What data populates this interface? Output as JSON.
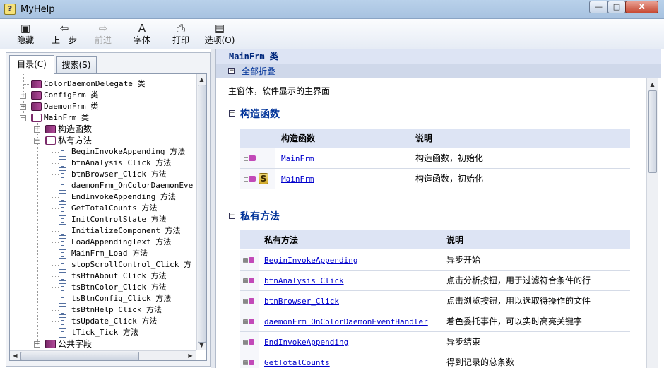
{
  "window": {
    "title": "MyHelp",
    "controls": {
      "minimize": "—",
      "maximize": "□",
      "close": "X"
    }
  },
  "toolbar": {
    "hide": {
      "label": "隐藏",
      "icon": "hide-pane-icon"
    },
    "back": {
      "label": "上一步",
      "icon": "back-arrow-icon"
    },
    "forward": {
      "label": "前进",
      "icon": "forward-arrow-icon",
      "disabled": true
    },
    "font": {
      "label": "字体",
      "icon": "font-icon"
    },
    "print": {
      "label": "打印",
      "icon": "printer-icon"
    },
    "options": {
      "label": "选项(O)",
      "icon": "options-icon"
    }
  },
  "left_panel": {
    "tabs": [
      {
        "label": "目录(C)",
        "active": true
      },
      {
        "label": "搜索(S)",
        "active": false
      }
    ],
    "tree": [
      "ColorDaemonDelegate 类",
      "ConfigFrm 类",
      "DaemonFrm 类",
      "MainFrm 类",
      "构造函数",
      "私有方法",
      "BeginInvokeAppending 方法",
      "btnAnalysis_Click 方法",
      "btnBrowser_Click 方法",
      "daemonFrm_OnColorDaemonEve",
      "EndInvokeAppending 方法",
      "GetTotalCounts 方法",
      "InitControlState 方法",
      "InitializeComponent 方法",
      "LoadAppendingText 方法",
      "MainFrm_Load 方法",
      "stopScrollControl_Click 方",
      "tsBtnAbout_Click 方法",
      "tsBtnColor_Click 方法",
      "tsBtnConfig_Click 方法",
      "tsBtnHelp_Click 方法",
      "tsUpdate_Click 方法",
      "tTick_Tick 方法",
      "公共字段"
    ]
  },
  "doc": {
    "title": "MainFrm 类",
    "collapse_all": "全部折叠",
    "description": "主窗体，软件显示的主界面",
    "constructors": {
      "heading": "构造函数",
      "columns": [
        "构造函数",
        "说明"
      ],
      "rows": [
        {
          "name": "MainFrm",
          "desc": "构造函数，初始化",
          "static": false
        },
        {
          "name": "MainFrm",
          "desc": "构造函数，初始化",
          "static": true
        }
      ]
    },
    "private_methods": {
      "heading": "私有方法",
      "columns": [
        "私有方法",
        "说明"
      ],
      "rows": [
        {
          "name": "BeginInvokeAppending",
          "desc": "异步开始"
        },
        {
          "name": "btnAnalysis_Click",
          "desc": "点击分析按钮，用于过滤符合条件的行"
        },
        {
          "name": "btnBrowser_Click",
          "desc": "点击浏览按钮，用以选取待操作的文件"
        },
        {
          "name": "daemonFrm_OnColorDaemonEventHandler",
          "desc": "着色委托事件，可以实时高亮关键字"
        },
        {
          "name": "EndInvokeAppending",
          "desc": "异步结束"
        },
        {
          "name": "GetTotalCounts",
          "desc": "得到记录的总条数"
        }
      ]
    }
  }
}
